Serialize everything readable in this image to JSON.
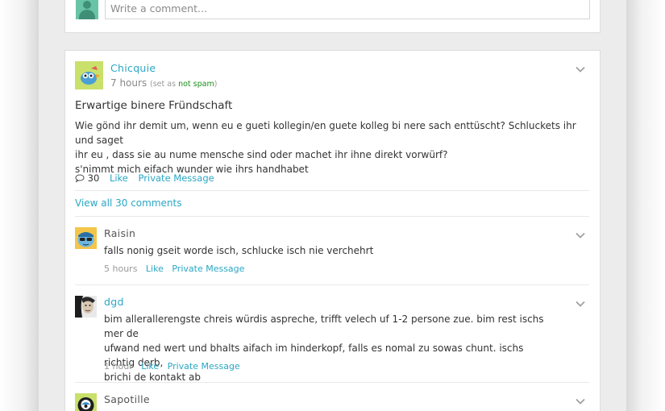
{
  "comment_box": {
    "placeholder": "Write a comment..."
  },
  "post": {
    "author": "Chicquie",
    "time": "7 hours",
    "set_as_prefix": "(set as ",
    "set_as_link": "not spam",
    "set_as_suffix": ")",
    "title": "Erwartige binere Fründschaft",
    "body_line1": "Wie gönd ihr demit um, wenn eu e gueti kollegin/en guete kolleg bi nere sach enttüscht? Schluckets ihr und saget",
    "body_line2": "ihr eu , dass sie au nume mensche sind oder machet ihr ihne direkt vorwürf?",
    "body_line3": "s'nimmt mich eifach wunder wie ihrs handhabet",
    "comment_count": "30",
    "like_label": "Like",
    "private_message_label": "Private Message",
    "view_all_label": "View all 30 comments"
  },
  "replies": [
    {
      "author": "Raisin",
      "author_color": "#555555",
      "text": "falls nonig gseit worde isch, schlucke isch nie verchehrt",
      "time": "5 hours",
      "like_label": "Like",
      "private_message_label": "Private Message"
    },
    {
      "author": "dgd",
      "author_color": "#2aa7c4",
      "text_line1": "bim allerallerengste chreis würdis aspreche, trifft velech uf 1-2 persone zue. bim rest ischs mer de",
      "text_line2": "ufwand ned wert und bhalts aifach im hinderkopf, falls es nomal zu sowas chunt. ischs richtig derb,",
      "text_line3": "brichi de kontakt ab",
      "time": "1 hour",
      "like_label": "Like",
      "private_message_label": "Private Message"
    },
    {
      "author": "Sapotille",
      "author_color": "#555555"
    }
  ],
  "icons": {
    "chevron": "chevron-down-icon",
    "comment": "speech-bubble-icon"
  },
  "colors": {
    "link": "#2aa7c4",
    "not_spam": "#1b8d1b"
  }
}
